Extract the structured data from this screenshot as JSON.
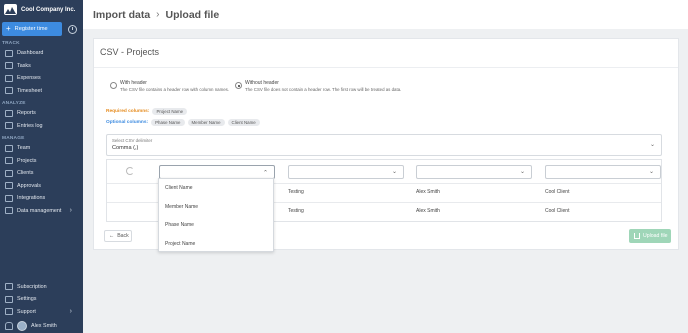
{
  "sidebar": {
    "company": "Cool Company Inc.",
    "register_label": "Register time",
    "sections": {
      "track": "TRACK",
      "analyze": "ANALYZE",
      "manage": "MANAGE"
    },
    "track_items": [
      {
        "label": "Dashboard",
        "icon": "dashboard-icon"
      },
      {
        "label": "Tasks",
        "icon": "tasks-icon"
      },
      {
        "label": "Expenses",
        "icon": "expenses-icon"
      },
      {
        "label": "Timesheet",
        "icon": "timesheet-icon"
      }
    ],
    "analyze_items": [
      {
        "label": "Reports",
        "icon": "reports-icon"
      },
      {
        "label": "Entries log",
        "icon": "entries-log-icon"
      }
    ],
    "manage_items": [
      {
        "label": "Team",
        "icon": "team-icon"
      },
      {
        "label": "Projects",
        "icon": "projects-icon"
      },
      {
        "label": "Clients",
        "icon": "clients-icon"
      },
      {
        "label": "Approvals",
        "icon": "approvals-icon"
      },
      {
        "label": "Integrations",
        "icon": "integrations-icon"
      },
      {
        "label": "Data management",
        "icon": "data-management-icon"
      }
    ],
    "bottom_items": [
      {
        "label": "Subscription",
        "icon": "subscription-icon"
      },
      {
        "label": "Settings",
        "icon": "settings-icon"
      },
      {
        "label": "Support",
        "icon": "support-icon"
      }
    ],
    "user_name": "Alex Smith"
  },
  "header": {
    "crumb1": "Import data",
    "crumb2": "Upload file"
  },
  "panel": {
    "title": "CSV - Projects",
    "options": {
      "with_header_title": "With header",
      "with_header_desc": "The CSV file contains a header row with column names.",
      "without_header_title": "Without header",
      "without_header_desc": "The CSV file does not contain a header row. The first row will be treated as data."
    },
    "required_label": "Required columns:",
    "required_chips": [
      "Project Name"
    ],
    "optional_label": "Optional columns:",
    "optional_chips": [
      "Phase Name",
      "Member Name",
      "Client Name"
    ],
    "delimiter_label": "Select CSV delimiter",
    "delimiter_value": "Comma (,)",
    "rows": [
      {
        "c2": "Testing",
        "c3": "Alex Smith",
        "c4": "Cool Client"
      },
      {
        "c2": "Testing",
        "c3": "Alex Smith",
        "c4": "Cool Client"
      }
    ],
    "dropdown_options": [
      "Client Name",
      "Member Name",
      "Phase Name",
      "Project Name"
    ],
    "back_label": "Back",
    "upload_label": "Upload file"
  },
  "colors": {
    "sidebar_bg": "#2c3e5a",
    "primary": "#3d8be0",
    "required": "#e58b1e",
    "upload_disabled": "#9fd6b8"
  }
}
